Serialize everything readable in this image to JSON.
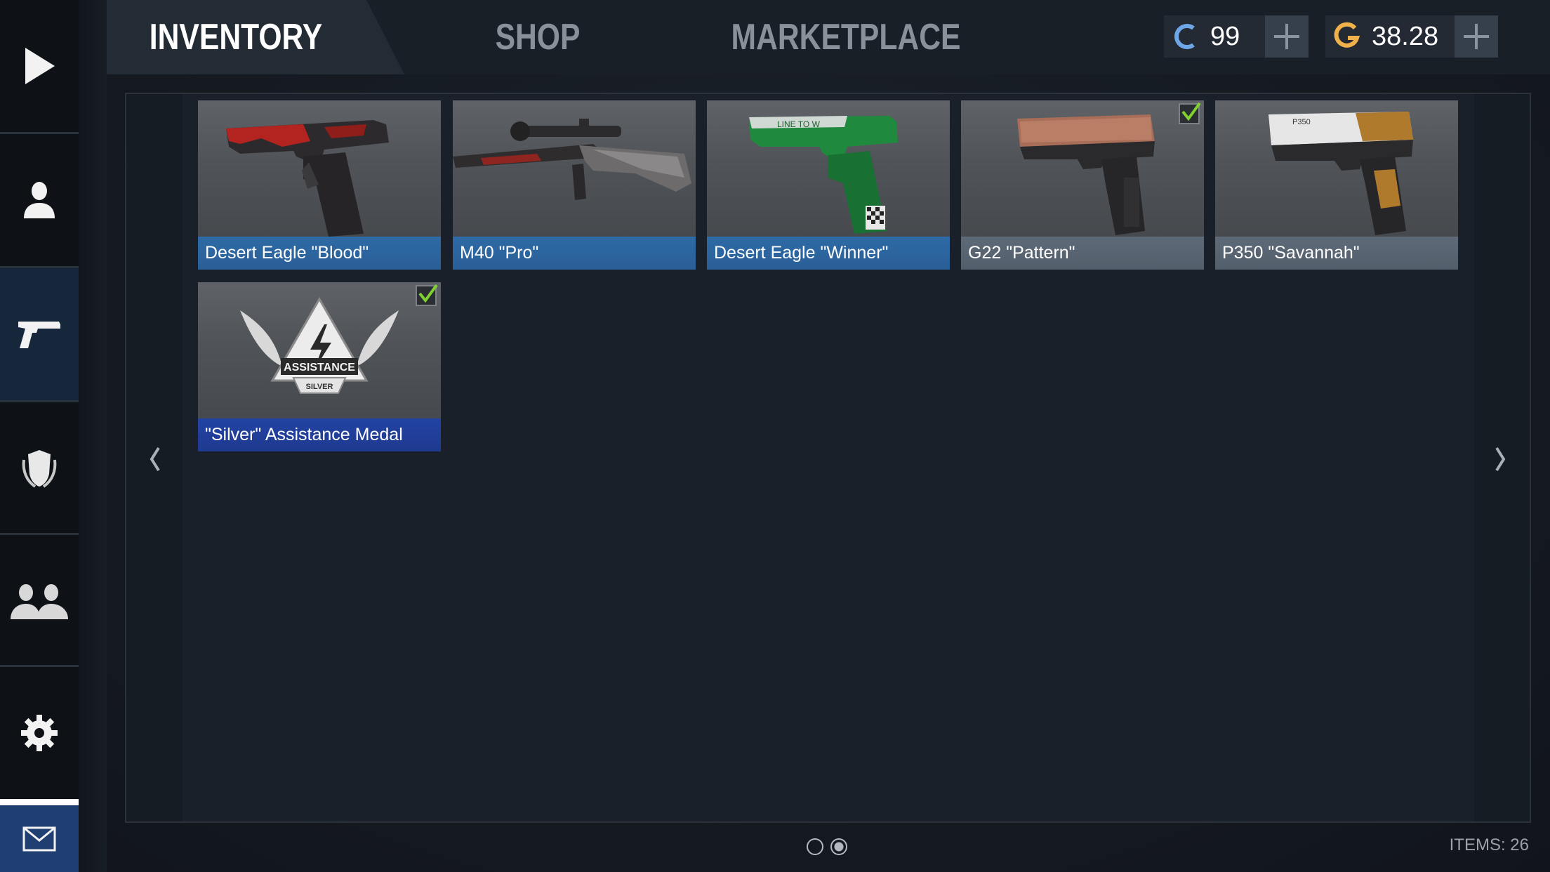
{
  "sidebar": {
    "items": [
      {
        "name": "play",
        "icon": "play-icon"
      },
      {
        "name": "profile",
        "icon": "person-icon"
      },
      {
        "name": "inventory",
        "icon": "pistol-icon",
        "active": true
      },
      {
        "name": "clan",
        "icon": "shield-icon"
      },
      {
        "name": "friends",
        "icon": "friends-icon"
      },
      {
        "name": "settings",
        "icon": "gear-icon"
      },
      {
        "name": "mail",
        "icon": "mail-icon"
      }
    ]
  },
  "tabs": [
    {
      "label": "INVENTORY",
      "active": true
    },
    {
      "label": "SHOP",
      "active": false
    },
    {
      "label": "MARKETPLACE",
      "active": false
    }
  ],
  "currency": {
    "coins": {
      "amount": "99",
      "icon": "coin-c-icon",
      "color": "#6fa6e8"
    },
    "gold": {
      "amount": "38.28",
      "icon": "gold-g-icon",
      "color": "#f0b04a"
    }
  },
  "inventory": {
    "items": [
      {
        "name": "Desert Eagle \"Blood\"",
        "rarity": "blue",
        "equipped": false
      },
      {
        "name": "M40 \"Pro\"",
        "rarity": "blue",
        "equipped": false
      },
      {
        "name": "Desert Eagle \"Winner\"",
        "rarity": "blue",
        "equipped": false
      },
      {
        "name": "G22 \"Pattern\"",
        "rarity": "grey",
        "equipped": true
      },
      {
        "name": "P350 \"Savannah\"",
        "rarity": "grey",
        "equipped": false
      },
      {
        "name": "\"Silver\" Assistance Medal",
        "rarity": "navy",
        "equipped": true
      }
    ],
    "medal_text": {
      "top": "ASSISTANCE",
      "bottom": "SILVER"
    },
    "deagle_winner_text": "LINE TO W",
    "p350_text": "P350",
    "pages": 2,
    "current_page": 2,
    "items_count": "ITEMS: 26"
  },
  "colors": {
    "rarity_blue": "#2e6aa6",
    "rarity_grey": "#5e6a78",
    "rarity_navy": "#2343a3",
    "check_green": "#7ed12f"
  }
}
